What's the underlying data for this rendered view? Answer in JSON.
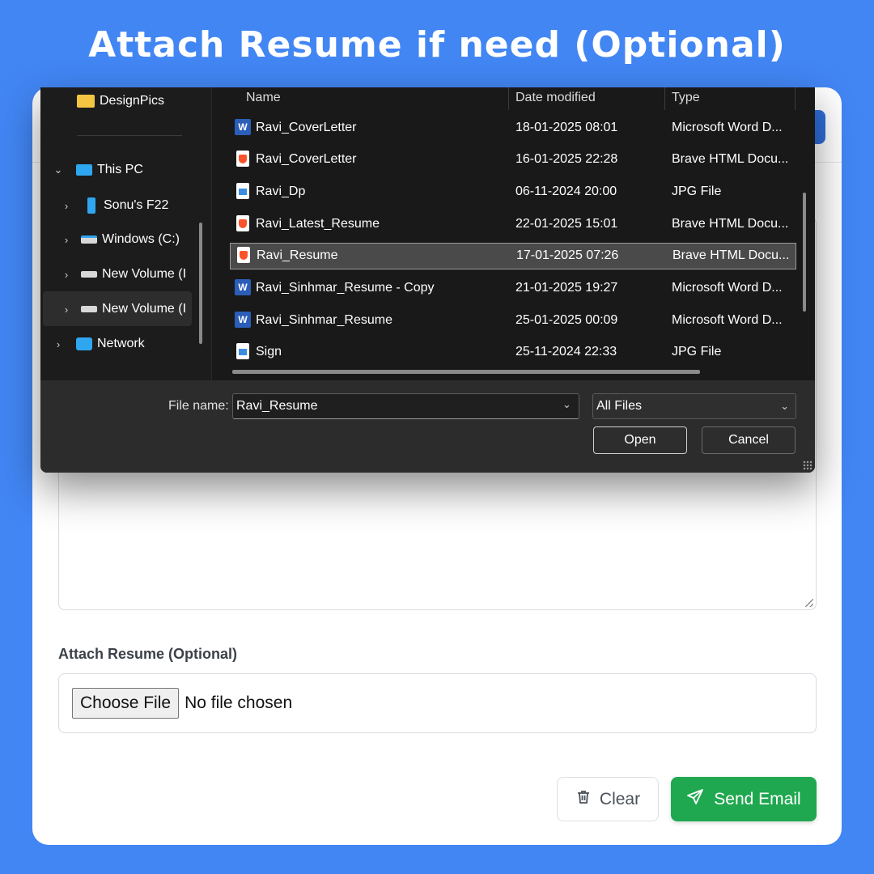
{
  "headline": "Attach Resume if need (Optional)",
  "form": {
    "attach_label": "Attach Resume (Optional)",
    "choose_file_label": "Choose File",
    "no_file_text": "No file chosen",
    "clear_label": "Clear",
    "send_label": "Send Email"
  },
  "dialog": {
    "nav": {
      "design_pics": "DesignPics",
      "this_pc": "This PC",
      "phone": "Sonu's F22",
      "windows_c": "Windows (C:)",
      "new_volume_1": "New Volume (I",
      "new_volume_2": "New Volume (I",
      "network": "Network"
    },
    "columns": {
      "name": "Name",
      "date": "Date modified",
      "type": "Type"
    },
    "files": [
      {
        "name": "Ravi_CoverLetter",
        "date": "18-01-2025 08:01",
        "type": "Microsoft Word D...",
        "icon": "word-doc-icon"
      },
      {
        "name": "Ravi_CoverLetter",
        "date": "16-01-2025 22:28",
        "type": "Brave HTML Docu...",
        "icon": "brave-html-icon"
      },
      {
        "name": "Ravi_Dp",
        "date": "06-11-2024 20:00",
        "type": "JPG File",
        "icon": "jpg-file-icon"
      },
      {
        "name": "Ravi_Latest_Resume",
        "date": "22-01-2025 15:01",
        "type": "Brave HTML Docu...",
        "icon": "brave-html-icon"
      },
      {
        "name": "Ravi_Resume",
        "date": "17-01-2025 07:26",
        "type": "Brave HTML Docu...",
        "icon": "brave-html-icon",
        "selected": true
      },
      {
        "name": "Ravi_Sinhmar_Resume - Copy",
        "date": "21-01-2025 19:27",
        "type": "Microsoft Word D...",
        "icon": "word-doc-icon"
      },
      {
        "name": "Ravi_Sinhmar_Resume",
        "date": "25-01-2025 00:09",
        "type": "Microsoft Word D...",
        "icon": "word-doc-icon"
      },
      {
        "name": "Sign",
        "date": "25-11-2024 22:33",
        "type": "JPG File",
        "icon": "jpg-file-icon"
      }
    ],
    "file_name_label": "File name:",
    "file_name_value": "Ravi_Resume",
    "file_type_value": "All Files",
    "open_label": "Open",
    "cancel_label": "Cancel"
  },
  "colors": {
    "background": "#4286f4",
    "send_button": "#1fa84f",
    "dialog_bg": "#1c1c1c",
    "selected_row": "#4a4a4a"
  }
}
